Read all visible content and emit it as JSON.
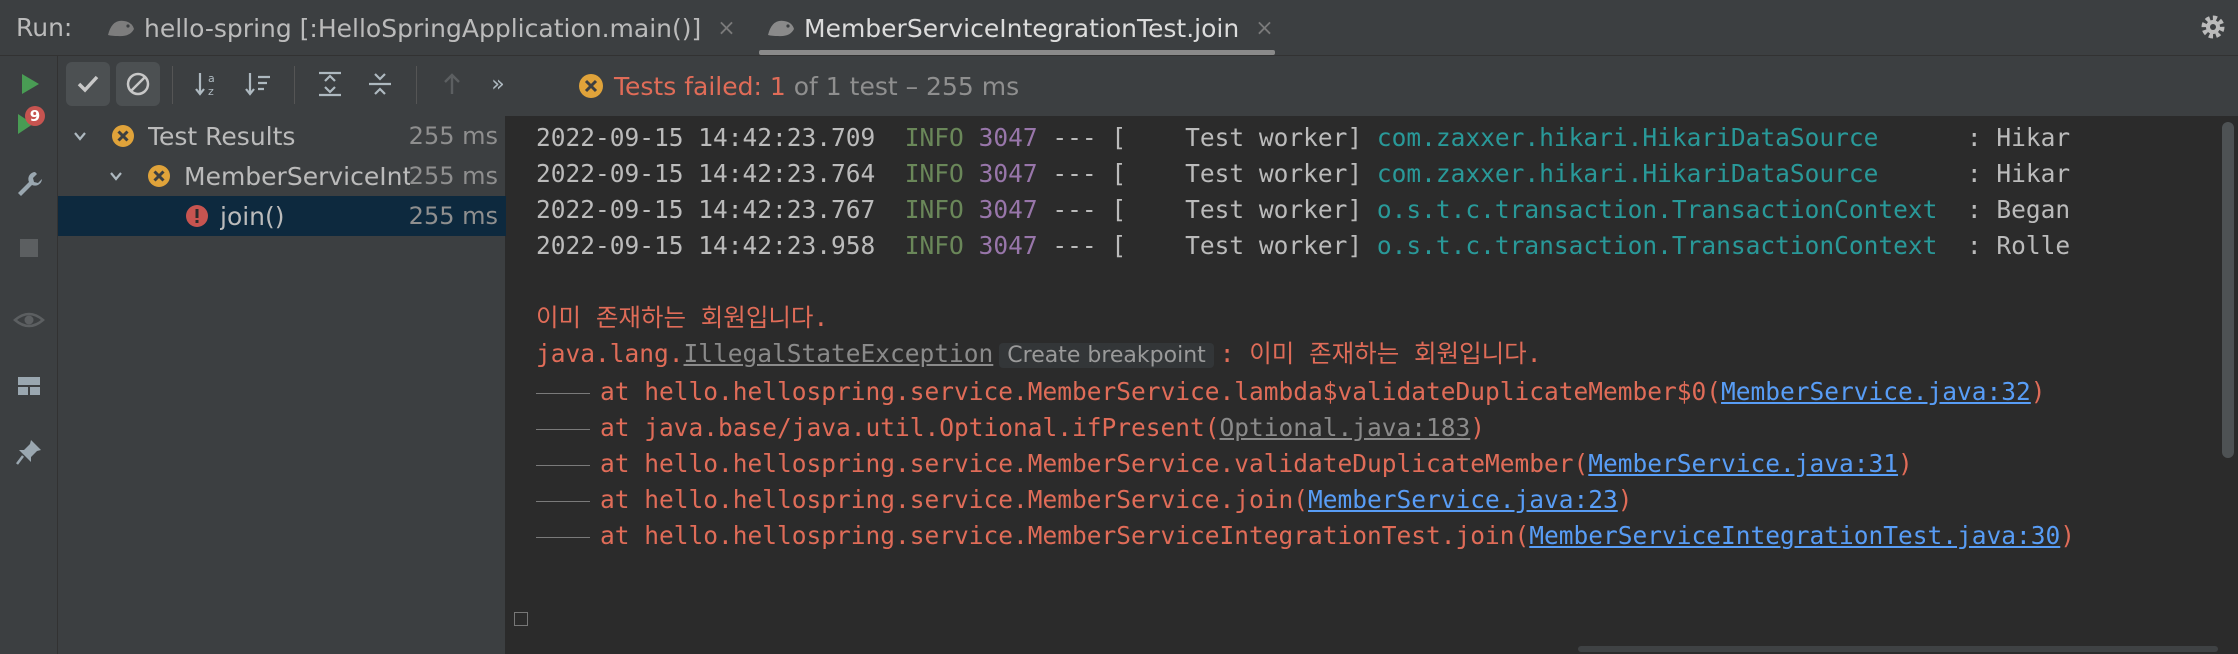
{
  "run": {
    "label": "Run:",
    "tabs": [
      {
        "label": "hello-spring [:HelloSpringApplication.main()]",
        "active": false,
        "close": "×"
      },
      {
        "label": "MemberServiceIntegrationTest.join",
        "active": true,
        "close": "×"
      }
    ]
  },
  "left_strip_icons": [
    "run-icon",
    "rerun-failed-icon",
    "wrench-icon",
    "stop-icon",
    "eye-icon",
    "layout-icon",
    "pin-icon"
  ],
  "rerun_badge": "9",
  "toolbar": {
    "icons": [
      "show-passed-icon",
      "show-ignored-icon",
      "sort-alpha-icon",
      "sort-duration-icon",
      "expand-all-icon",
      "collapse-all-icon",
      "previous-failed-icon",
      "more-icon"
    ],
    "more": "»",
    "status_failed": "Tests failed: 1",
    "status_rest": "of 1 test – 255 ms"
  },
  "tree": [
    {
      "label": "Test Results",
      "time": "255 ms"
    },
    {
      "label": "MemberServiceInte",
      "time": "255 ms"
    },
    {
      "label": "join()",
      "time": "255 ms"
    }
  ],
  "console": {
    "logs": [
      {
        "ts": "2022-09-15 14:42:23.709",
        "level": "INFO",
        "pid": "3047",
        "sep": "--- [",
        "thread": "    Test worker]",
        "cls": "com.zaxxer.hikari.HikariDataSource",
        "msg": ": Hikar"
      },
      {
        "ts": "2022-09-15 14:42:23.764",
        "level": "INFO",
        "pid": "3047",
        "sep": "--- [",
        "thread": "    Test worker]",
        "cls": "com.zaxxer.hikari.HikariDataSource",
        "msg": ": Hikar"
      },
      {
        "ts": "2022-09-15 14:42:23.767",
        "level": "INFO",
        "pid": "3047",
        "sep": "--- [",
        "thread": "    Test worker]",
        "cls": "o.s.t.c.transaction.TransactionContext",
        "msg": ": Began"
      },
      {
        "ts": "2022-09-15 14:42:23.958",
        "level": "INFO",
        "pid": "3047",
        "sep": "--- [",
        "thread": "    Test worker]",
        "cls": "o.s.t.c.transaction.TransactionContext",
        "msg": ": Rolle"
      }
    ],
    "error_message": "이미 존재하는 회원입니다.",
    "exception_prefix": "java.lang.",
    "exception_name": "IllegalStateException",
    "create_breakpoint": "Create breakpoint",
    "exception_suffix": ": 이미 존재하는 회원입니다.",
    "stack": [
      {
        "text": "at hello.hellospring.service.MemberService.lambda$validateDuplicateMember$0(",
        "link": "MemberService.java:32",
        "end": ")",
        "link_style": "link"
      },
      {
        "text": "at java.base/java.util.Optional.ifPresent(",
        "link": "Optional.java:183",
        "end": ")",
        "link_style": "glink"
      },
      {
        "text": "at hello.hellospring.service.MemberService.validateDuplicateMember(",
        "link": "MemberService.java:31",
        "end": ")",
        "link_style": "link"
      },
      {
        "text": "at hello.hellospring.service.MemberService.join(",
        "link": "MemberService.java:23",
        "end": ")",
        "link_style": "link"
      },
      {
        "text": "at hello.hellospring.service.MemberServiceIntegrationTest.join(",
        "link": "MemberServiceIntegrationTest.java:30",
        "end": ")",
        "link_style": "link"
      }
    ]
  }
}
